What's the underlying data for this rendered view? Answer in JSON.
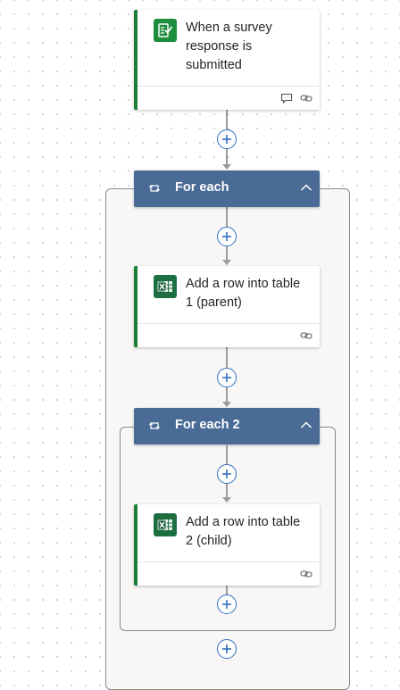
{
  "trigger": {
    "title": "When a survey response is submitted",
    "icon": "forms-icon"
  },
  "for_each_1": {
    "title": "For each",
    "icon": "loop-icon"
  },
  "action_1": {
    "title": "Add a row into table 1 (parent)",
    "icon": "excel-icon"
  },
  "for_each_2": {
    "title": "For each 2",
    "icon": "loop-icon"
  },
  "action_2": {
    "title": "Add a row into table 2 (child)",
    "icon": "excel-icon"
  },
  "colors": {
    "accent": "#2f6fbe",
    "loop_header": "#4a6b95",
    "card_border": "#1e7e34",
    "forms_green": "#1e8e3e",
    "excel_green": "#1d6f42"
  }
}
